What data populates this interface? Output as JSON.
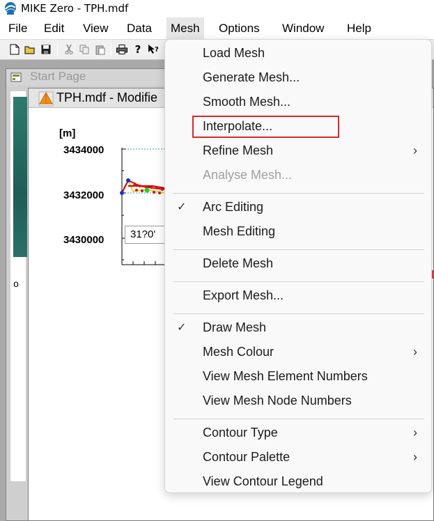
{
  "app": {
    "title": "MIKE Zero - TPH.mdf"
  },
  "menubar": {
    "items": [
      {
        "label": "File"
      },
      {
        "label": "Edit"
      },
      {
        "label": "View"
      },
      {
        "label": "Data"
      },
      {
        "label": "Mesh"
      },
      {
        "label": "Options"
      },
      {
        "label": "Window"
      },
      {
        "label": "Help"
      }
    ],
    "active": "Mesh"
  },
  "toolbar": {
    "buttons": [
      "new-file-icon",
      "open-folder-icon",
      "save-icon",
      "cut-icon",
      "copy-icon",
      "paste-icon",
      "print-icon",
      "help-icon",
      "context-help-icon"
    ]
  },
  "start_page": {
    "title": "Start Page",
    "fragment": "o"
  },
  "tph_window": {
    "title": "TPH.mdf - Modifie",
    "unit": "[m]",
    "y_ticks": [
      "3434000",
      "3432000",
      "3430000"
    ],
    "coordinate_readout": "31?0'"
  },
  "mesh_menu": {
    "highlighted": "Interpolate...",
    "highlight_color": "#d9262c",
    "groups": [
      [
        {
          "label": "Load Mesh",
          "enabled": true,
          "checked": false,
          "submenu": false
        },
        {
          "label": "Generate Mesh...",
          "enabled": true,
          "checked": false,
          "submenu": false
        },
        {
          "label": "Smooth Mesh...",
          "enabled": true,
          "checked": false,
          "submenu": false
        },
        {
          "label": "Interpolate...",
          "enabled": true,
          "checked": false,
          "submenu": false
        },
        {
          "label": "Refine Mesh",
          "enabled": true,
          "checked": false,
          "submenu": true
        },
        {
          "label": "Analyse Mesh...",
          "enabled": false,
          "checked": false,
          "submenu": false
        }
      ],
      [
        {
          "label": "Arc Editing",
          "enabled": true,
          "checked": true,
          "submenu": false
        },
        {
          "label": "Mesh Editing",
          "enabled": true,
          "checked": false,
          "submenu": false
        }
      ],
      [
        {
          "label": "Delete Mesh",
          "enabled": true,
          "checked": false,
          "submenu": false
        }
      ],
      [
        {
          "label": "Export Mesh...",
          "enabled": true,
          "checked": false,
          "submenu": false
        }
      ],
      [
        {
          "label": "Draw Mesh",
          "enabled": true,
          "checked": true,
          "submenu": false
        },
        {
          "label": "Mesh Colour",
          "enabled": true,
          "checked": false,
          "submenu": true
        },
        {
          "label": "View Mesh Element Numbers",
          "enabled": true,
          "checked": false,
          "submenu": false
        },
        {
          "label": "View Mesh Node Numbers",
          "enabled": true,
          "checked": false,
          "submenu": false
        }
      ],
      [
        {
          "label": "Contour Type",
          "enabled": true,
          "checked": false,
          "submenu": true
        },
        {
          "label": "Contour Palette",
          "enabled": true,
          "checked": false,
          "submenu": true
        },
        {
          "label": "View Contour Legend",
          "enabled": true,
          "checked": false,
          "submenu": false
        }
      ]
    ]
  }
}
